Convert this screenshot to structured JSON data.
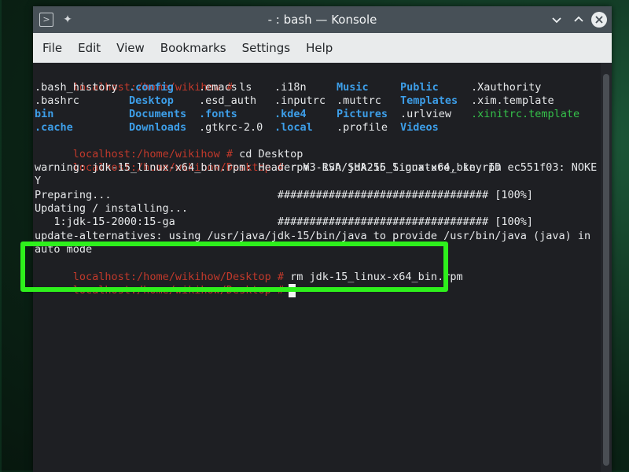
{
  "window": {
    "title": "- : bash — Konsole"
  },
  "icons": {
    "app": "terminal-icon",
    "pin": "pin-icon",
    "minimize": "chevron-down-icon",
    "maximize": "chevron-up-icon",
    "close": "close-icon"
  },
  "menu": [
    "File",
    "Edit",
    "View",
    "Bookmarks",
    "Settings",
    "Help"
  ],
  "colors": {
    "prompt": "#c0392b",
    "directory": "#3d9ee8",
    "executable": "#35c14a",
    "highlight_box": "#2ef01c"
  },
  "terminal": {
    "l0": {
      "prompt": "localhost:/home/wikihow #",
      "cmd": " ls"
    },
    "listing": [
      [
        ".bash_history",
        ".config",
        ".emacs",
        ".i18n",
        "Music",
        "Public",
        ".Xauthority"
      ],
      [
        ".bashrc",
        "Desktop",
        ".esd_auth",
        ".inputrc",
        ".muttrc",
        "Templates",
        ".xim.template"
      ],
      [
        "bin",
        "Documents",
        ".fonts",
        ".kde4",
        "Pictures",
        ".urlview",
        ".xinitrc.template"
      ],
      [
        ".cache",
        "Downloads",
        ".gtkrc-2.0",
        ".local",
        ".profile",
        "Videos",
        ""
      ]
    ],
    "l5": {
      "prompt": "localhost:/home/wikihow #",
      "cmd": " cd Desktop"
    },
    "l6": {
      "prompt": "localhost:/home/wikihow/Desktop #",
      "cmd": " rpm -ivh jdk-15_linux-x64_bin.rpm"
    },
    "l7": "warning: jdk-15_linux-x64_bin.rpm: Header V3 RSA/SHA256 Signature, key ID ec551f03: NOKE",
    "l8": "Y",
    "l9": "Preparing...                          ################################# [100%]",
    "l10": "Updating / installing...",
    "l11": "   1:jdk-15-2000:15-ga                ################################# [100%]",
    "l12": "update-alternatives: using /usr/java/jdk-15/bin/java to provide /usr/bin/java (java) in",
    "l13": "auto mode",
    "l14": {
      "prompt": "localhost:/home/wikihow/Desktop #",
      "cmd": " rm jdk-15_linux-x64_bin.rpm"
    },
    "l15": {
      "prompt": "localhost:/home/wikihow/Desktop #",
      "cmd": ""
    }
  }
}
